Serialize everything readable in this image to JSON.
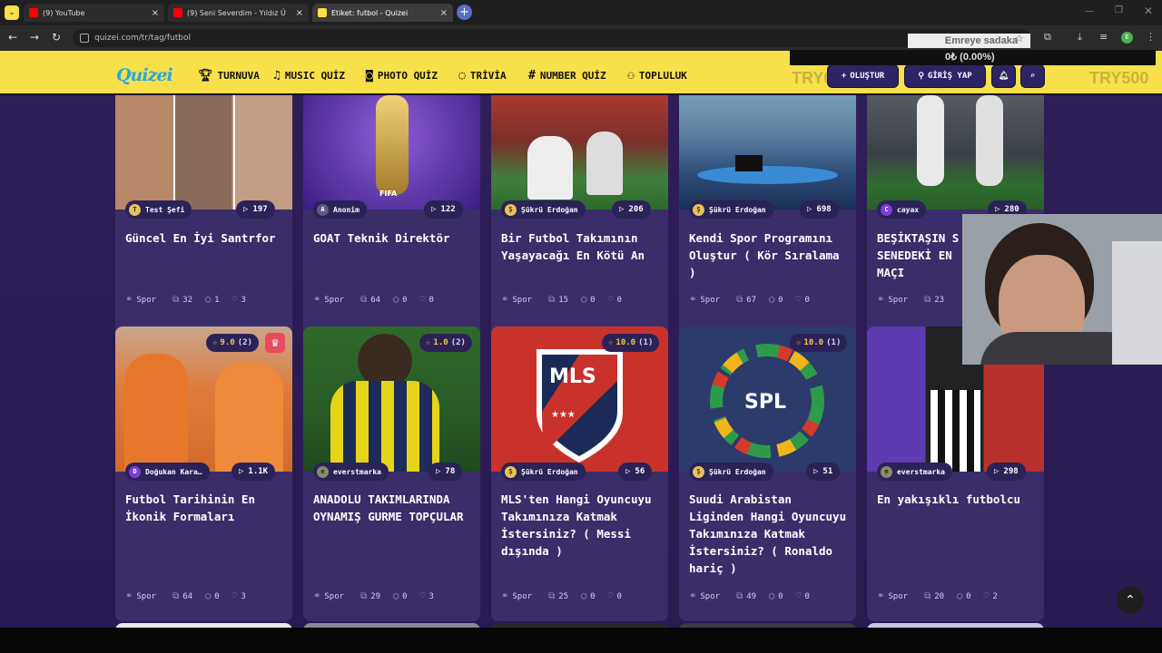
{
  "browser": {
    "tabs": [
      {
        "label": "(9) YouTube",
        "color": "#ff0000"
      },
      {
        "label": "(9) Seni Severdim - Yıldız Ü",
        "color": "#ff0000"
      },
      {
        "label": "Etiket: futbol - Quizei",
        "color": "#f7e04a"
      }
    ],
    "url": "quizei.com/tr/tag/futbol"
  },
  "overlay": {
    "donation_text": "Emreye sadaka",
    "donation_amount": "0₺ (0.00%)"
  },
  "site": {
    "logo": "Quizei",
    "nav": [
      {
        "label": "TURNUVA",
        "icon": "trophy-icon"
      },
      {
        "label": "MUSIC QUİZ",
        "icon": "music-icon"
      },
      {
        "label": "PHOTO QUİZ",
        "icon": "camera-icon"
      },
      {
        "label": "TRİVİA",
        "icon": "chat-icon"
      },
      {
        "label": "NUMBER QUİZ",
        "icon": "hash-icon"
      },
      {
        "label": "TOPLULUK",
        "icon": "users-icon"
      }
    ],
    "try_left": "TRY0",
    "try_right": "TRY500",
    "create_label": "OLUŞTUR",
    "login_label": "GİRİŞ YAP"
  },
  "cards_row1": [
    {
      "author": "Test Şefi",
      "plays": "197",
      "title": "Güncel En İyi Santrfor",
      "category": "Spor",
      "questions": "32",
      "comments": "1",
      "likes": "3"
    },
    {
      "author": "Anonim",
      "plays": "122",
      "title": "GOAT Teknik Direktör",
      "category": "Spor",
      "questions": "64",
      "comments": "0",
      "likes": "0"
    },
    {
      "author": "Şükrü Erdoğan",
      "plays": "206",
      "title": "Bir Futbol Takımının Yaşayacağı En Kötü An",
      "category": "Spor",
      "questions": "15",
      "comments": "0",
      "likes": "0"
    },
    {
      "author": "Şükrü Erdoğan",
      "plays": "698",
      "title": "Kendi Spor Programını Oluştur ( Kör Sıralama )",
      "category": "Spor",
      "questions": "67",
      "comments": "0",
      "likes": "0"
    },
    {
      "author": "cayax",
      "plays": "280",
      "title": "BEŞİKTAŞIN S SENEDEKİ EN MAÇI",
      "category": "Spor",
      "questions": "23",
      "comments": "",
      "likes": ""
    }
  ],
  "cards_row2": [
    {
      "author": "Doğukan Kara…",
      "plays": "1.1K",
      "rating": "9.0",
      "rating_count": "(2)",
      "title": "Futbol Tarihinin En İkonik Formaları",
      "category": "Spor",
      "questions": "64",
      "comments": "0",
      "likes": "3"
    },
    {
      "author": "everstmarka",
      "plays": "78",
      "rating": "1.0",
      "rating_count": "(2)",
      "title": "ANADOLU TAKIMLARINDA OYNAMIŞ GURME TOPÇULAR",
      "category": "Spor",
      "questions": "29",
      "comments": "0",
      "likes": "3"
    },
    {
      "author": "Şükrü Erdoğan",
      "plays": "56",
      "rating": "10.0",
      "rating_count": "(1)",
      "title": "MLS'ten Hangi Oyuncuyu Takımınıza Katmak İstersiniz? ( Messi dışında )",
      "category": "Spor",
      "questions": "25",
      "comments": "0",
      "likes": "0"
    },
    {
      "author": "Şükrü Erdoğan",
      "plays": "51",
      "rating": "10.0",
      "rating_count": "(1)",
      "title": "Suudi Arabistan Liginden Hangi Oyuncuyu Takımınıza Katmak İstersiniz? ( Ronaldo hariç )",
      "category": "Spor",
      "questions": "49",
      "comments": "0",
      "likes": "0"
    },
    {
      "author": "everstmarka",
      "plays": "298",
      "title": "En yakışıklı futbolcu",
      "category": "Spor",
      "questions": "20",
      "comments": "0",
      "likes": "2"
    }
  ],
  "thumb_text": {
    "mls": "MLS",
    "spl": "SPL",
    "fifa": "FIFA"
  }
}
